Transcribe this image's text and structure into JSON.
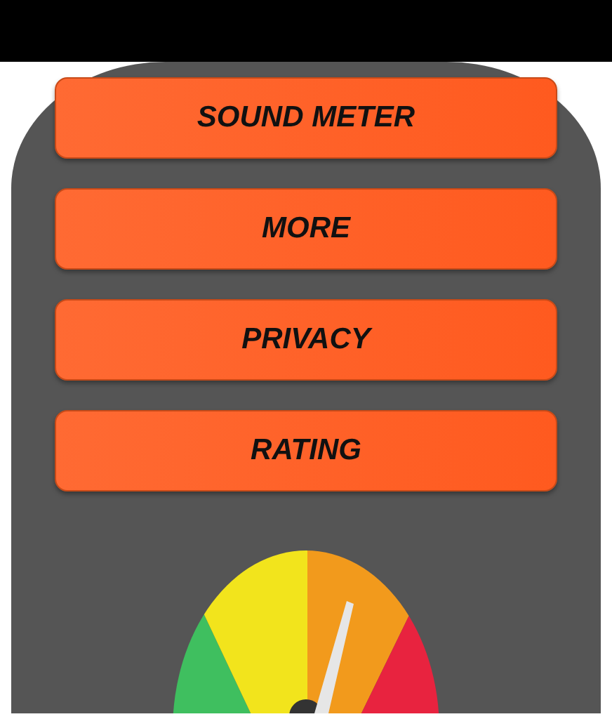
{
  "menu_buttons": [
    {
      "label": "SOUND METER"
    },
    {
      "label": "MORE"
    },
    {
      "label": "PRIVACY"
    },
    {
      "label": "RATING"
    }
  ]
}
